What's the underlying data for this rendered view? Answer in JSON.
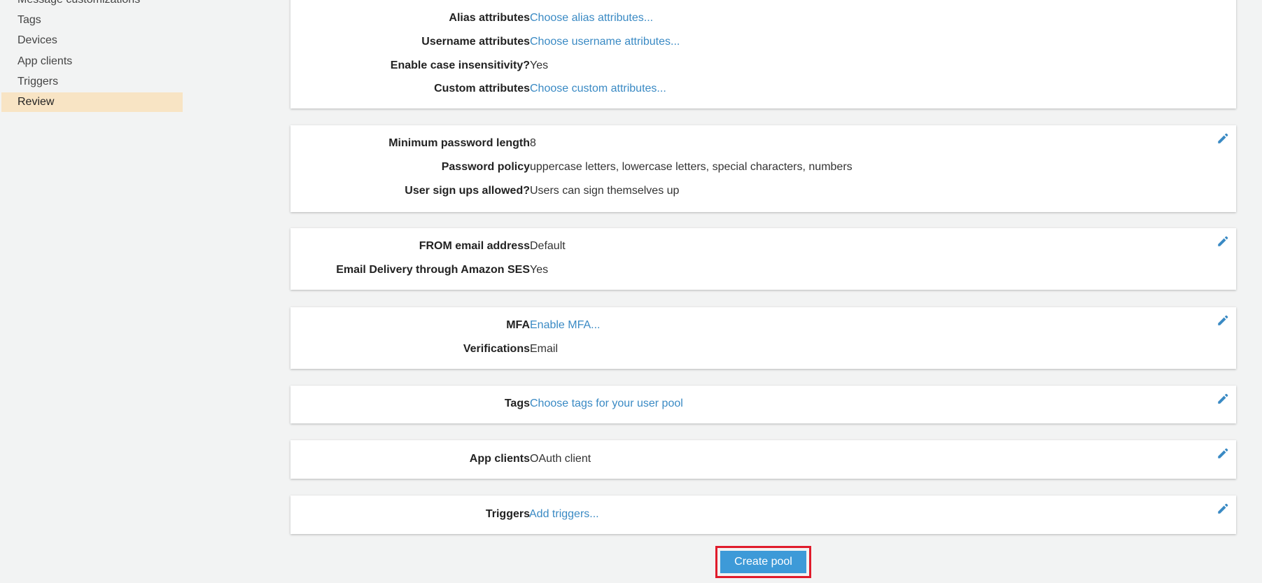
{
  "sidebar": {
    "items": [
      {
        "label": "Message customizations"
      },
      {
        "label": "Tags"
      },
      {
        "label": "Devices"
      },
      {
        "label": "App clients"
      },
      {
        "label": "Triggers"
      },
      {
        "label": "Review"
      }
    ],
    "active": "Review"
  },
  "attributes": {
    "alias_label": "Alias attributes",
    "alias_value": "Choose alias attributes...",
    "username_label": "Username attributes",
    "username_value": "Choose username attributes...",
    "case_label": "Enable case insensitivity?",
    "case_value": "Yes",
    "custom_label": "Custom attributes",
    "custom_value": "Choose custom attributes..."
  },
  "policies": {
    "minlen_label": "Minimum password length",
    "minlen_value": "8",
    "policy_label": "Password policy",
    "policy_value": "uppercase letters, lowercase letters, special characters, numbers",
    "signup_label": "User sign ups allowed?",
    "signup_value": "Users can sign themselves up"
  },
  "email": {
    "from_label": "FROM email address",
    "from_value": "Default",
    "ses_label": "Email Delivery through Amazon SES",
    "ses_value": "Yes"
  },
  "mfa": {
    "mfa_label": "MFA",
    "mfa_value": "Enable MFA...",
    "verif_label": "Verifications",
    "verif_value": "Email"
  },
  "tags": {
    "label": "Tags",
    "value": "Choose tags for your user pool"
  },
  "app_clients": {
    "label": "App clients",
    "value": "OAuth client"
  },
  "triggers": {
    "label": "Triggers",
    "value": "Add triggers..."
  },
  "create_button": {
    "label": "Create pool"
  },
  "colors": {
    "link": "#3a8ac4",
    "button": "#3d9ad8",
    "highlight": "#e01b2b",
    "active_nav": "#f8e4c4"
  },
  "icons": {
    "edit": "pencil-icon"
  }
}
